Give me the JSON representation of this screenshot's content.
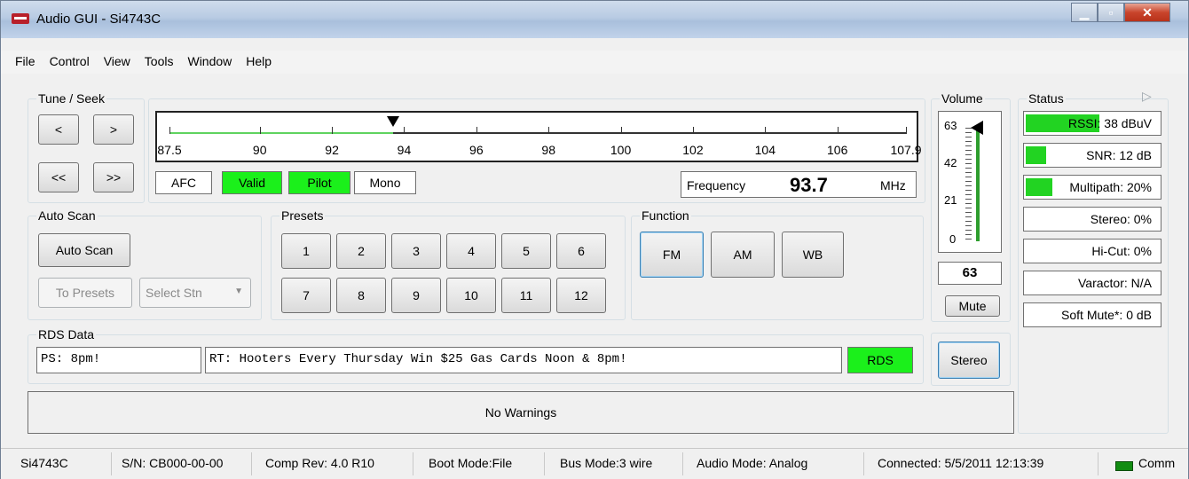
{
  "window": {
    "title": "Audio GUI - Si4743C"
  },
  "menu": [
    "File",
    "Control",
    "View",
    "Tools",
    "Window",
    "Help"
  ],
  "tune_seek": {
    "label": "Tune / Seek",
    "buttons": [
      "<",
      ">",
      "<<",
      ">>"
    ]
  },
  "tuner": {
    "ticks": [
      "87.5",
      "90",
      "92",
      "94",
      "96",
      "98",
      "100",
      "102",
      "104",
      "106",
      "107.9"
    ],
    "min_mhz": 87.5,
    "max_mhz": 107.9,
    "current_mhz": 93.7,
    "indicators": [
      {
        "label": "AFC",
        "on": false
      },
      {
        "label": "Valid",
        "on": true
      },
      {
        "label": "Pilot",
        "on": true
      },
      {
        "label": "Mono",
        "on": false
      }
    ],
    "frequency_label": "Frequency",
    "frequency_value": "93.7",
    "unit": "MHz"
  },
  "auto_scan": {
    "label": "Auto Scan",
    "scan_button": "Auto Scan",
    "to_presets_button": "To Presets",
    "select_placeholder": "Select Stn"
  },
  "presets": {
    "label": "Presets",
    "buttons": [
      "1",
      "2",
      "3",
      "4",
      "5",
      "6",
      "7",
      "8",
      "9",
      "10",
      "11",
      "12"
    ]
  },
  "function": {
    "label": "Function",
    "buttons": [
      "FM",
      "AM",
      "WB"
    ],
    "selected": "FM"
  },
  "volume": {
    "label": "Volume",
    "ticks": [
      "63",
      "42",
      "21",
      "0"
    ],
    "value": "63",
    "level": 1.0,
    "mute_button": "Mute"
  },
  "rds": {
    "label": "RDS Data",
    "ps": "PS: 8pm!",
    "rt": "RT: Hooters Every Thursday Win $25 Gas Cards Noon & 8pm!",
    "indicator": "RDS"
  },
  "stereo_button": "Stereo",
  "warnings": "No Warnings",
  "status": {
    "label": "Status",
    "fields": [
      {
        "text": "RSSI: 38 dBuV",
        "fill": 0.55
      },
      {
        "text": "SNR: 12 dB",
        "fill": 0.15
      },
      {
        "text": "Multipath: 20%",
        "fill": 0.2
      },
      {
        "text": "Stereo: 0%",
        "fill": 0
      },
      {
        "text": "Hi-Cut: 0%",
        "fill": 0
      },
      {
        "text": "Varactor: N/A",
        "fill": 0
      },
      {
        "text": "Soft Mute*: 0 dB",
        "fill": 0
      }
    ]
  },
  "statusbar": {
    "chip": "Si4743C",
    "serial": "S/N: CB000-00-00",
    "comp_rev": "Comp Rev: 4.0 R10",
    "boot_mode": "Boot Mode:File",
    "bus_mode": "Bus Mode:3 wire",
    "audio_mode": "Audio Mode: Analog",
    "connected": "Connected: 5/5/2011 12:13:39",
    "comm": "Comm"
  }
}
